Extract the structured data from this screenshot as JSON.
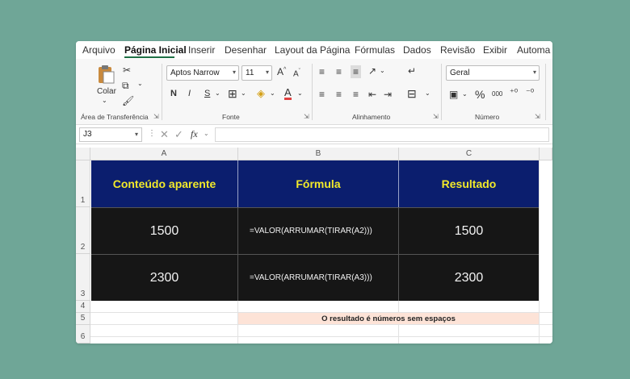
{
  "menu": {
    "tabs": [
      "Arquivo",
      "Página Inicial",
      "Inserir",
      "Desenhar",
      "Layout da Página",
      "Fórmulas",
      "Dados",
      "Revisão",
      "Exibir",
      "Automa"
    ],
    "active_tab": "Página Inicial"
  },
  "ribbon": {
    "clipboard": {
      "paste_label": "Colar",
      "group_label": "Área de Transferência"
    },
    "font": {
      "name": "Aptos Narrow",
      "size": "11",
      "bold": "N",
      "italic": "I",
      "underline": "S",
      "group_label": "Fonte"
    },
    "alignment": {
      "group_label": "Alinhamento"
    },
    "number": {
      "format": "Geral",
      "percent": "%",
      "thousands": "000",
      "group_label": "Número"
    }
  },
  "formula_bar": {
    "name_box": "J3",
    "fx": "fx",
    "value": ""
  },
  "sheet": {
    "columns": [
      "A",
      "B",
      "C"
    ],
    "rows": [
      "1",
      "2",
      "3",
      "4",
      "5",
      "6"
    ],
    "header": [
      "Conteúdo aparente",
      "Fórmula",
      "Resultado"
    ],
    "data": [
      {
        "apparent": "1500",
        "formula": "=VALOR(ARRUMAR(TIRAR(A2)))",
        "result": "1500"
      },
      {
        "apparent": "2300",
        "formula": "=VALOR(ARRUMAR(TIRAR(A3)))",
        "result": "2300"
      }
    ],
    "note": "O resultado é números sem espaços"
  },
  "colors": {
    "header_bg": "#0b1e6e",
    "header_text": "#f2e92a",
    "data_bg": "#161616",
    "note_bg": "#fde3d7",
    "background": "#6fa697"
  }
}
